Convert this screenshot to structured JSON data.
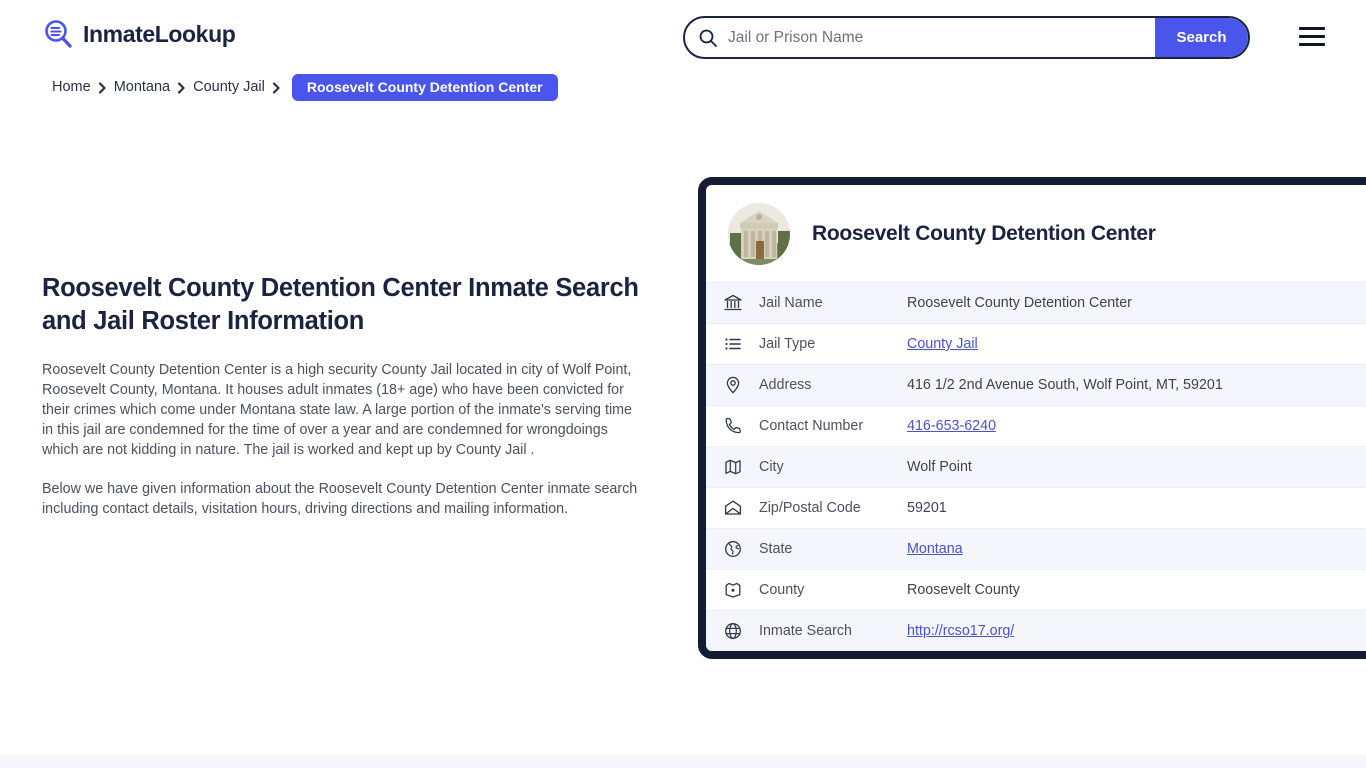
{
  "brand": {
    "name": "InmateLookup",
    "logo_icon": "magnifier-list-icon",
    "accent_color": "#4a55ec",
    "dark_color": "#1b2340"
  },
  "search": {
    "placeholder": "Jail or Prison Name",
    "value": "",
    "button_label": "Search",
    "icon": "search-icon"
  },
  "menu": {
    "icon": "hamburger-menu-icon"
  },
  "breadcrumb": {
    "items": [
      {
        "label": "Home"
      },
      {
        "label": "Montana"
      },
      {
        "label": "County Jail"
      }
    ],
    "current": "Roosevelt County Detention Center",
    "separator_icon": "chevron-right-icon"
  },
  "article": {
    "heading": "Roosevelt County Detention Center Inmate Search and Jail Roster Information",
    "paragraph1": "Roosevelt County Detention Center is a high security County Jail located in city of Wolf Point, Roosevelt County, Montana. It houses adult inmates (18+ age) who have been convicted for their crimes which come under Montana state law. A large portion of the inmate's serving time in this jail are condemned for the time of over a year and are condemned for wrongdoings which are not kidding in nature. The jail is worked and kept up by County Jail .",
    "paragraph2": "Below we have given information about the Roosevelt County Detention Center inmate search including contact details, visitation hours, driving directions and mailing information."
  },
  "card": {
    "title": "Roosevelt County Detention Center",
    "thumbnail_icon": "courthouse-building-photo",
    "rows": [
      {
        "icon": "bank-building-icon",
        "label": "Jail Name",
        "value": "Roosevelt County Detention Center",
        "link": false
      },
      {
        "icon": "list-icon",
        "label": "Jail Type",
        "value": "County Jail",
        "link": true
      },
      {
        "icon": "map-pin-icon",
        "label": "Address",
        "value": "416 1/2 2nd Avenue South, Wolf Point, MT, 59201",
        "link": false
      },
      {
        "icon": "phone-icon",
        "label": "Contact Number",
        "value": "416-653-6240",
        "link": true
      },
      {
        "icon": "map-icon",
        "label": "City",
        "value": "Wolf Point",
        "link": false
      },
      {
        "icon": "envelope-open-icon",
        "label": "Zip/Postal Code",
        "value": "59201",
        "link": false
      },
      {
        "icon": "globe-americas-icon",
        "label": "State",
        "value": "Montana",
        "link": true
      },
      {
        "icon": "badge-icon",
        "label": "County",
        "value": "Roosevelt County",
        "link": false
      },
      {
        "icon": "globe-icon",
        "label": "Inmate Search",
        "value": "http://rcso17.org/",
        "link": true
      }
    ]
  }
}
